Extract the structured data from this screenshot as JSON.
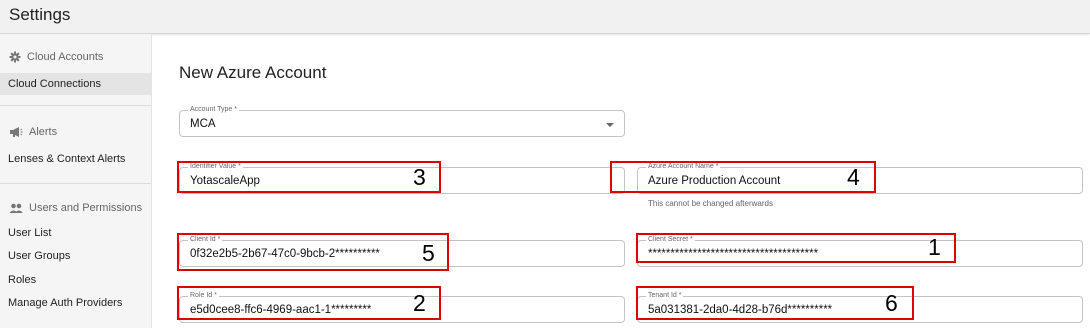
{
  "header": {
    "title": "Settings"
  },
  "sidebar": {
    "cloud_accounts": "Cloud Accounts",
    "cloud_connections": "Cloud Connections",
    "alerts": "Alerts",
    "lenses_context_alerts": "Lenses & Context Alerts",
    "users_permissions": "Users and Permissions",
    "user_list": "User List",
    "user_groups": "User Groups",
    "roles": "Roles",
    "manage_auth": "Manage Auth Providers"
  },
  "form": {
    "title": "New Azure Account",
    "account_type": {
      "label": "Account Type *",
      "value": "MCA"
    },
    "identifier_value": {
      "label": "Identifier Value *",
      "value": "YotascaleApp"
    },
    "azure_account_name": {
      "label": "Azure Account Name *",
      "value": "Azure Production Account",
      "helper": "This cannot be changed afterwards"
    },
    "client_id": {
      "label": "Client Id *",
      "value": "0f32e2b5-2b67-47c0-9bcb-2**********"
    },
    "client_secret": {
      "label": "Client Secret *",
      "value": "**************************************"
    },
    "role_id": {
      "label": "Role Id *",
      "value": "e5d0cee8-ffc6-4969-aac1-1*********"
    },
    "tenant_id": {
      "label": "Tenant Id *",
      "value": "5a031381-2da0-4d28-b76d**********"
    }
  },
  "annotations": [
    "3",
    "4",
    "5",
    "1",
    "2",
    "6"
  ],
  "colors": {
    "annotation_box": "#e00000",
    "sidebar_bg": "#f5f5f5",
    "active_item_bg": "#e4e4e4"
  },
  "icons": [
    "gear-icon",
    "megaphone-icon",
    "users-icon",
    "chevron-down-icon"
  ]
}
